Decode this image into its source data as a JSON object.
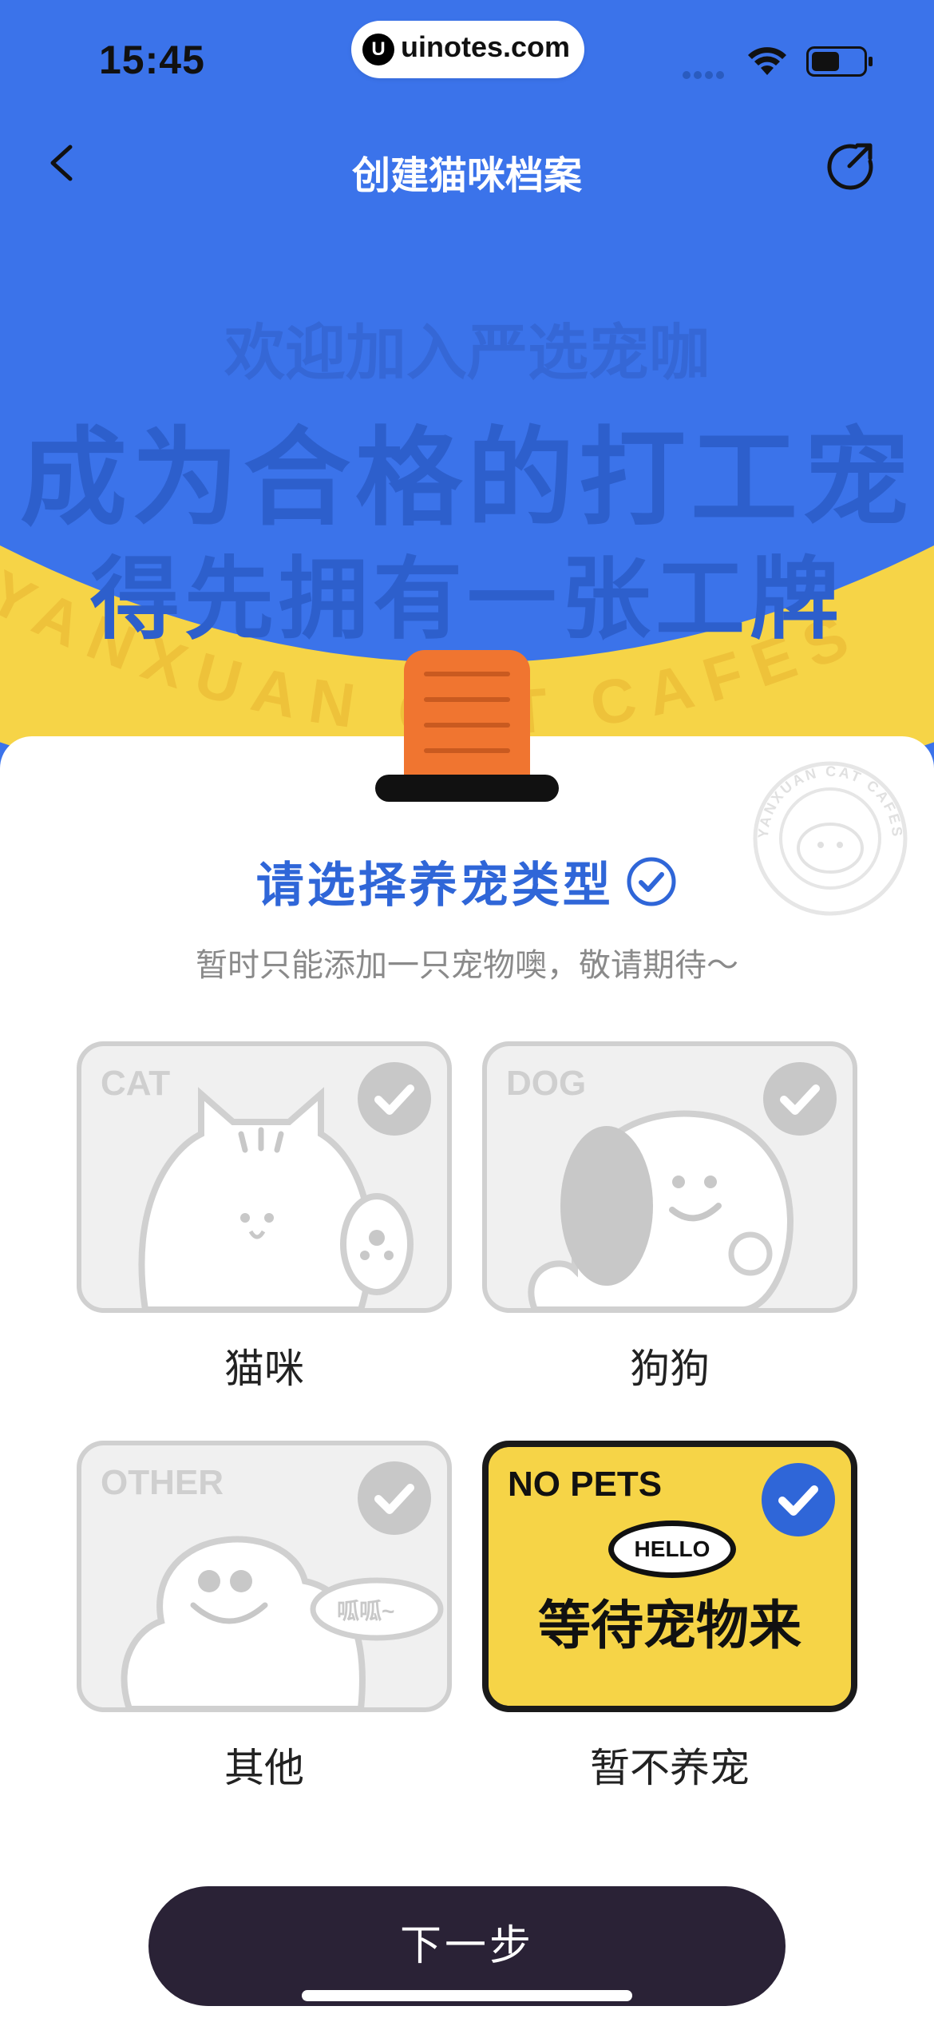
{
  "status_bar": {
    "time": "15:45",
    "url": "uinotes.com",
    "url_icon": "U"
  },
  "nav": {
    "title": "创建猫咪档案",
    "back_icon": "chevron-left-icon",
    "share_icon": "share-icon"
  },
  "hero": {
    "line1": "欢迎加入严选宠咖",
    "line2": "成为合格的打工宠",
    "line3": "得先拥有一张工牌",
    "band_text": "YANXUAN CAT CAFES",
    "stamp_text": "YANXUAN CAT CAFES"
  },
  "section": {
    "title": "请选择养宠类型",
    "subtitle": "暂时只能添加一只宠物噢，敬请期待～"
  },
  "options": [
    {
      "tag": "CAT",
      "label": "猫咪",
      "selected": false
    },
    {
      "tag": "DOG",
      "label": "狗狗",
      "selected": false
    },
    {
      "tag": "OTHER",
      "label": "其他",
      "selected": false,
      "bubble": "呱呱~"
    },
    {
      "tag": "NO PETS",
      "label": "暂不养宠",
      "selected": true,
      "hello": "HELLO",
      "wait": "等待宠物来"
    }
  ],
  "footer": {
    "next_label": "下一步"
  },
  "colors": {
    "primary_blue": "#3b73ea",
    "accent_blue": "#2f66d8",
    "yellow": "#f6d447",
    "button_dark": "#2a2236",
    "badge_orange": "#f07530"
  }
}
